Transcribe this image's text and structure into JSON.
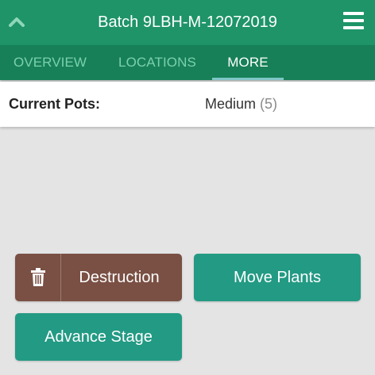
{
  "header": {
    "title": "Batch 9LBH-M-12072019",
    "back_icon": "chevron-up-icon",
    "menu_icon": "hamburger-menu-icon"
  },
  "tabs": [
    {
      "label": "OVERVIEW",
      "active": false
    },
    {
      "label": "LOCATIONS",
      "active": false
    },
    {
      "label": "MORE",
      "active": true
    }
  ],
  "info": {
    "label": "Current Pots:",
    "value": "Medium",
    "count": "(5)"
  },
  "actions": {
    "destruction_label": "Destruction",
    "destruction_icon": "trash-icon",
    "move_label": "Move Plants",
    "advance_label": "Advance Stage"
  },
  "colors": {
    "header": "#1e9468",
    "tabs": "#178058",
    "tab_indicator": "#7fc6c6",
    "destruction": "#7a5044",
    "primary_button": "#239a84",
    "background": "#e4e4e4"
  }
}
